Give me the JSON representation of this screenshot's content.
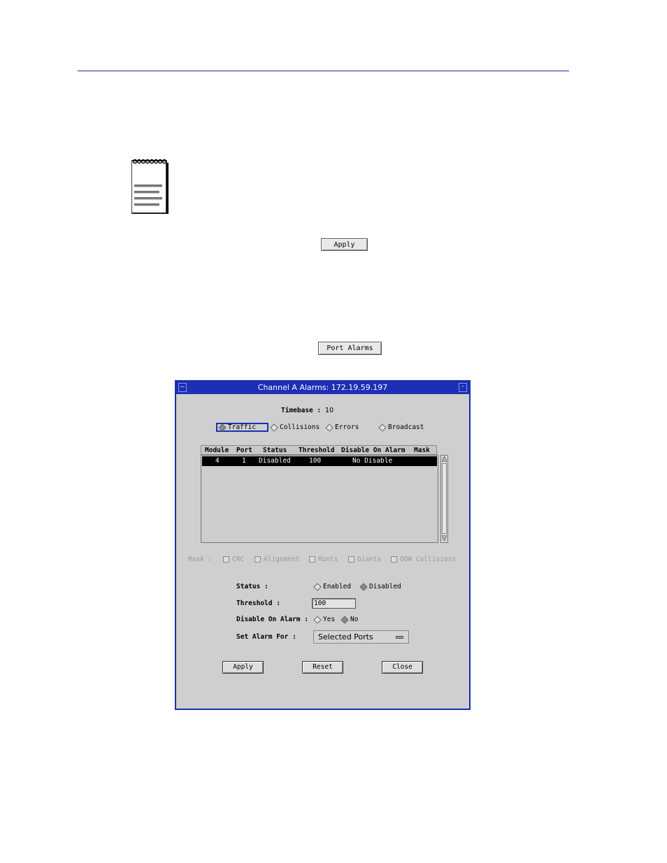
{
  "doc": {
    "apply_button": "Apply",
    "port_alarms_button": "Port Alarms"
  },
  "dialog": {
    "title": "Channel A Alarms: 172.19.59.197",
    "timebase_label": "Timebase :",
    "timebase_value": "10",
    "radio_traffic": "Traffic",
    "radio_collisions": "Collisions",
    "radio_errors": "Errors",
    "radio_broadcast": "Broadcast",
    "columns": [
      "Module",
      "Port",
      "Status",
      "Threshold",
      "Disable On Alarm",
      "Mask"
    ],
    "rows": [
      {
        "module": "4",
        "port": "1",
        "status": "Disabled",
        "threshold": "100",
        "disable_on_alarm": "No Disable",
        "mask": ""
      }
    ],
    "mask_label": "Mask :",
    "mask_crc": "CRC",
    "mask_alignment": "Alignment",
    "mask_runts": "Runts",
    "mask_giants": "Giants",
    "mask_oow": "OOW Collisions",
    "status_label": "Status :",
    "status_enabled": "Enabled",
    "status_disabled": "Disabled",
    "threshold_label": "Threshold :",
    "threshold_value": "100",
    "disable_label": "Disable On Alarm :",
    "disable_yes": "Yes",
    "disable_no": "No",
    "set_alarm_label": "Set Alarm For :",
    "set_alarm_value": "Selected Ports",
    "apply": "Apply",
    "reset": "Reset",
    "close": "Close"
  }
}
